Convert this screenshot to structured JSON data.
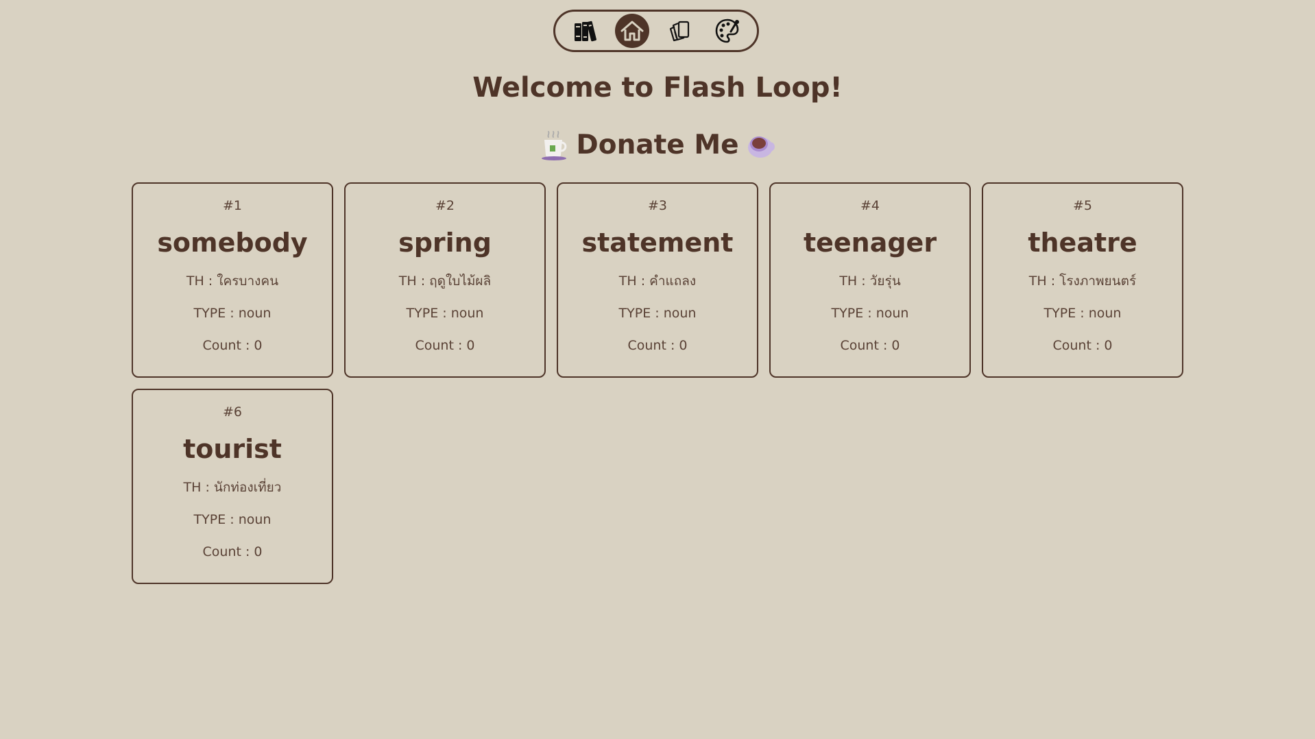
{
  "title": "Welcome to Flash Loop!",
  "donate": {
    "label": "Donate Me",
    "left_icon": "tea-cup-icon",
    "right_icon": "coffee-cup-icon"
  },
  "nav": {
    "items": [
      {
        "name": "library",
        "icon": "books-icon",
        "active": false
      },
      {
        "name": "home",
        "icon": "home-icon",
        "active": true
      },
      {
        "name": "cards",
        "icon": "cards-icon",
        "active": false
      },
      {
        "name": "theme",
        "icon": "palette-icon",
        "active": false
      }
    ]
  },
  "colors": {
    "background": "#d9d2c2",
    "accent": "#4e3428"
  },
  "cards": [
    {
      "num": "#1",
      "word": "somebody",
      "th": "TH : ใครบางคน",
      "type": "TYPE : noun",
      "count": "Count : 0"
    },
    {
      "num": "#2",
      "word": "spring",
      "th": "TH : ฤดูใบไม้ผลิ",
      "type": "TYPE : noun",
      "count": "Count : 0"
    },
    {
      "num": "#3",
      "word": "statement",
      "th": "TH : คำแถลง",
      "type": "TYPE : noun",
      "count": "Count : 0"
    },
    {
      "num": "#4",
      "word": "teenager",
      "th": "TH : วัยรุ่น",
      "type": "TYPE : noun",
      "count": "Count : 0"
    },
    {
      "num": "#5",
      "word": "theatre",
      "th": "TH : โรงภาพยนตร์",
      "type": "TYPE : noun",
      "count": "Count : 0"
    },
    {
      "num": "#6",
      "word": "tourist",
      "th": "TH : นักท่องเที่ยว",
      "type": "TYPE : noun",
      "count": "Count : 0"
    }
  ]
}
